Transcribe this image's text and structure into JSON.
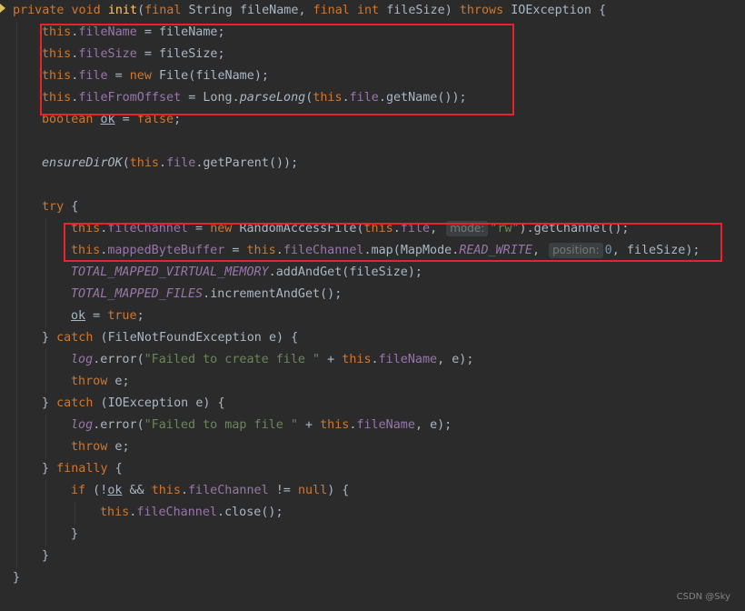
{
  "editor": {
    "accent_colors": {
      "background": "#2b2b2b",
      "keyword": "#cc7832",
      "field": "#9876aa",
      "method": "#ffc66d",
      "string": "#6a8759",
      "number": "#6897bb",
      "text": "#a9b7c6",
      "highlight_box": "#e8232b"
    },
    "hints": {
      "mode": "mode:",
      "position": "position:"
    },
    "tokens": {
      "private": "private",
      "void": "void",
      "init": "init",
      "final": "final",
      "String": "String",
      "int": "int",
      "throws": "throws",
      "IOException": "IOException",
      "this": "this",
      "fileName": "fileName",
      "fileSize": "fileSize",
      "file": "file",
      "new": "new",
      "File": "File",
      "fileFromOffset": "fileFromOffset",
      "Long": "Long",
      "parseLong": "parseLong",
      "getName": "getName",
      "boolean": "boolean",
      "ok": "ok",
      "false": "false",
      "true": "true",
      "ensureDirOK": "ensureDirOK",
      "getParent": "getParent",
      "try": "try",
      "fileChannel": "fileChannel",
      "RandomAccessFile": "RandomAccessFile",
      "rw": "\"rw\"",
      "getChannel": "getChannel",
      "mappedByteBuffer": "mappedByteBuffer",
      "map": "map",
      "MapMode": "MapMode",
      "READ_WRITE": "READ_WRITE",
      "zero": "0",
      "TOTAL_MAPPED_VIRTUAL_MEMORY": "TOTAL_MAPPED_VIRTUAL_MEMORY",
      "addAndGet": "addAndGet",
      "TOTAL_MAPPED_FILES": "TOTAL_MAPPED_FILES",
      "incrementAndGet": "incrementAndGet",
      "catch": "catch",
      "FileNotFoundException": "FileNotFoundException",
      "e": "e",
      "log": "log",
      "error": "error",
      "failed_create": "\"Failed to create file \"",
      "failed_map": "\"Failed to map file \"",
      "throw": "throw",
      "finally": "finally",
      "if": "if",
      "null": "null",
      "close": "close"
    },
    "watermark": "CSDN @Sky"
  }
}
